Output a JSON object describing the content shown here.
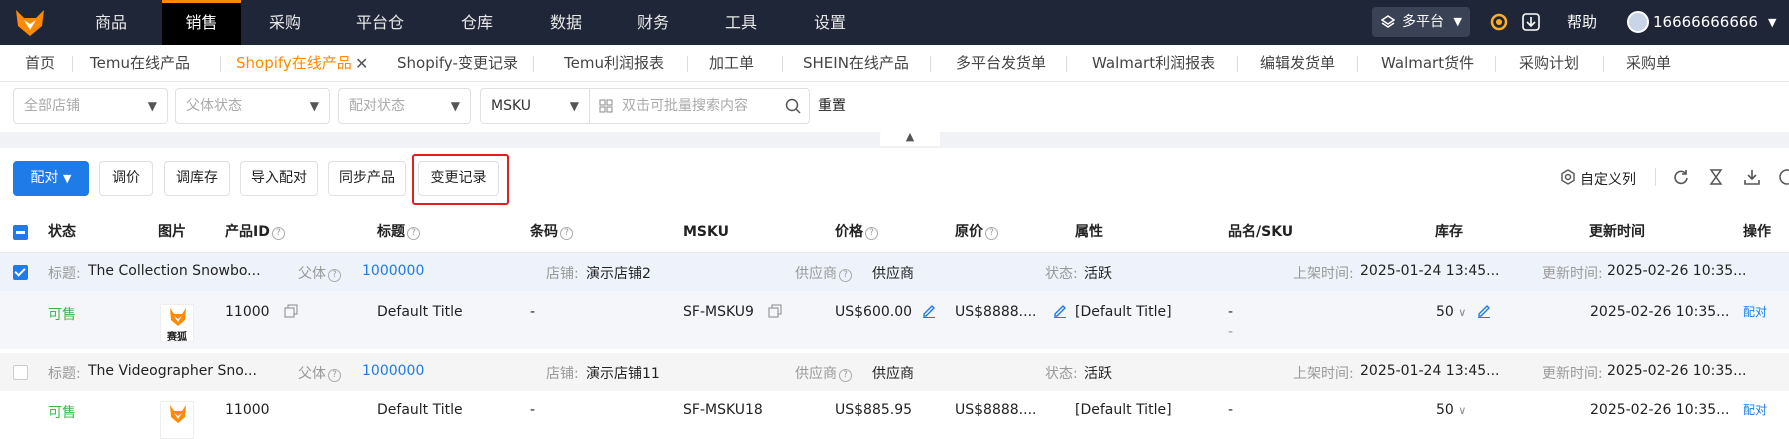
{
  "nav": {
    "items": [
      "商品",
      "销售",
      "采购",
      "平台仓",
      "仓库",
      "数据",
      "财务",
      "工具",
      "设置"
    ],
    "active": "销售",
    "platform_select": "多平台",
    "help": "帮助",
    "user": "16666666666"
  },
  "tabs": {
    "items": [
      "首页",
      "Temu在线产品",
      "Shopify在线产品",
      "Shopify-变更记录",
      "Temu利润报表",
      "加工单",
      "SHEIN在线产品",
      "多平台发货单",
      "Walmart利润报表",
      "编辑发货单",
      "Walmart货件",
      "采购计划",
      "采购单"
    ],
    "active": "Shopify在线产品",
    "close": "✕"
  },
  "filters": {
    "store": "全部店铺",
    "parent_status": "父体状态",
    "pair_status": "配对状态",
    "search_type": "MSKU",
    "search_placeholder": "双击可批量搜索内容",
    "reset": "重置"
  },
  "toolbar": {
    "pair": "配对",
    "adjust_price": "调价",
    "adjust_stock": "调库存",
    "import_pair": "导入配对",
    "sync_products": "同步产品",
    "change_log": "变更记录",
    "custom_columns": "自定义列"
  },
  "table": {
    "headers": {
      "status": "状态",
      "image": "图片",
      "product_id": "产品ID",
      "title": "标题",
      "barcode": "条码",
      "msku": "MSKU",
      "price": "价格",
      "original_price": "原价",
      "attributes": "属性",
      "name_sku": "品名/SKU",
      "stock": "库存",
      "updated": "更新时间",
      "action": "操作"
    },
    "groups": [
      {
        "checked": true,
        "title_label": "标题:",
        "title": "The Collection Snowbo...",
        "parent_label": "父体",
        "parent_id": "1000000",
        "store_label": "店铺:",
        "store": "演示店铺2",
        "supplier_label": "供应商",
        "supplier": "供应商",
        "state_label": "状态:",
        "state": "活跃",
        "listed_label": "上架时间:",
        "listed": "2025-01-24 13:45...",
        "updated_label": "更新时间:",
        "updated": "2025-02-26 10:35...",
        "row": {
          "status": "可售",
          "img_text": "赛狐",
          "product_id": "11000",
          "title": "Default Title",
          "barcode": "-",
          "msku": "SF-MSKU9",
          "price": "US$600.00",
          "original_price": "US$8888....",
          "attributes": "[Default Title]",
          "name_sku": "-",
          "name_sku2": "-",
          "stock": "50",
          "updated": "2025-02-26 10:35...",
          "action": "配对"
        }
      },
      {
        "checked": false,
        "title_label": "标题:",
        "title": "The Videographer Sno...",
        "parent_label": "父体",
        "parent_id": "1000000",
        "store_label": "店铺:",
        "store": "演示店铺11",
        "supplier_label": "供应商",
        "supplier": "供应商",
        "state_label": "状态:",
        "state": "活跃",
        "listed_label": "上架时间:",
        "listed": "2025-01-24 13:45...",
        "updated_label": "更新时间:",
        "updated": "2025-02-26 10:35...",
        "row": {
          "status": "可售",
          "product_id": "11000",
          "title": "Default Title",
          "barcode": "-",
          "msku": "SF-MSKU18",
          "price": "US$885.95",
          "original_price": "US$8888....",
          "attributes": "[Default Title]",
          "name_sku": "-",
          "stock": "50",
          "updated": "2025-02-26 10:35...",
          "action": "配对"
        }
      }
    ]
  },
  "colors": {
    "accent": "#ff8a00",
    "primary": "#1e7be8",
    "nav_bg": "#1f2638",
    "highlight": "#e02020",
    "available": "#3bb64a"
  }
}
